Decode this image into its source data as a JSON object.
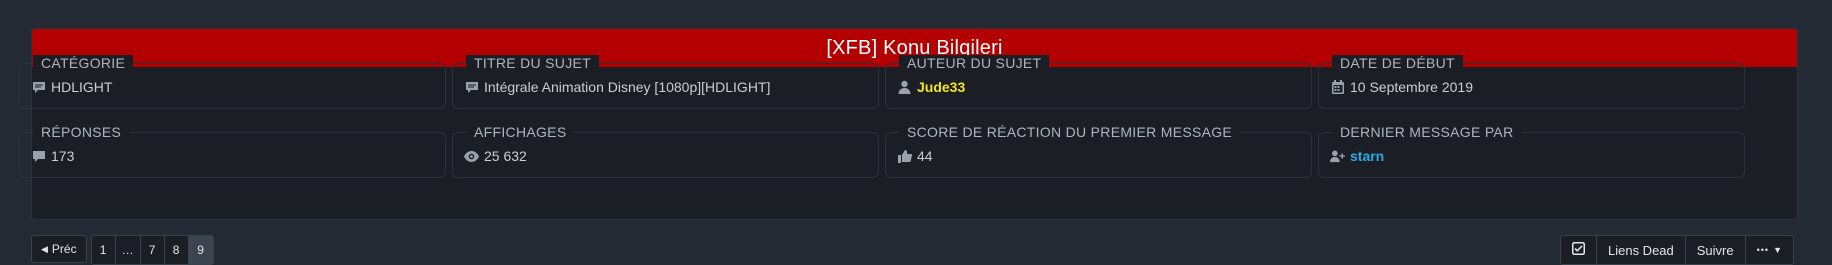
{
  "panel": {
    "title": "[XFB] Konu Bilgileri"
  },
  "fields": [
    {
      "label": "CATÉGORIE",
      "value": "HDLIGHT",
      "icon": "comment-icon"
    },
    {
      "label": "TITRE DU SUJET",
      "value": "Intégrale Animation Disney [1080p][HDLIGHT]",
      "icon": "comment-icon"
    },
    {
      "label": "AUTEUR DU SUJET",
      "value": "Jude33",
      "icon": "user-icon",
      "color": "#f2e51c"
    },
    {
      "label": "DATE DE DÉBUT",
      "value": "10 Septembre 2019",
      "icon": "calendar-icon"
    },
    {
      "label": "RÉPONSES",
      "value": "173",
      "icon": "comment-icon"
    },
    {
      "label": "AFFICHAGES",
      "value": "25 632",
      "icon": "eye-icon"
    },
    {
      "label": "SCORE DE RÉACTION DU PREMIER MESSAGE",
      "value": "44",
      "icon": "thumbs-up-icon"
    },
    {
      "label": "DERNIER MESSAGE PAR",
      "value": "starn",
      "icon": "user-plus-icon",
      "color": "#29a8e6"
    }
  ],
  "pagination": {
    "prev_label": "Préc",
    "pages": [
      "1",
      "…",
      "7",
      "8",
      "9"
    ],
    "current": "9"
  },
  "actions": {
    "dead_links_label": "Liens Dead",
    "follow_label": "Suivre",
    "more_label": "•••"
  },
  "colors": {
    "header": "#b30000",
    "background": "#232a33",
    "panel": "#1b1f25"
  }
}
